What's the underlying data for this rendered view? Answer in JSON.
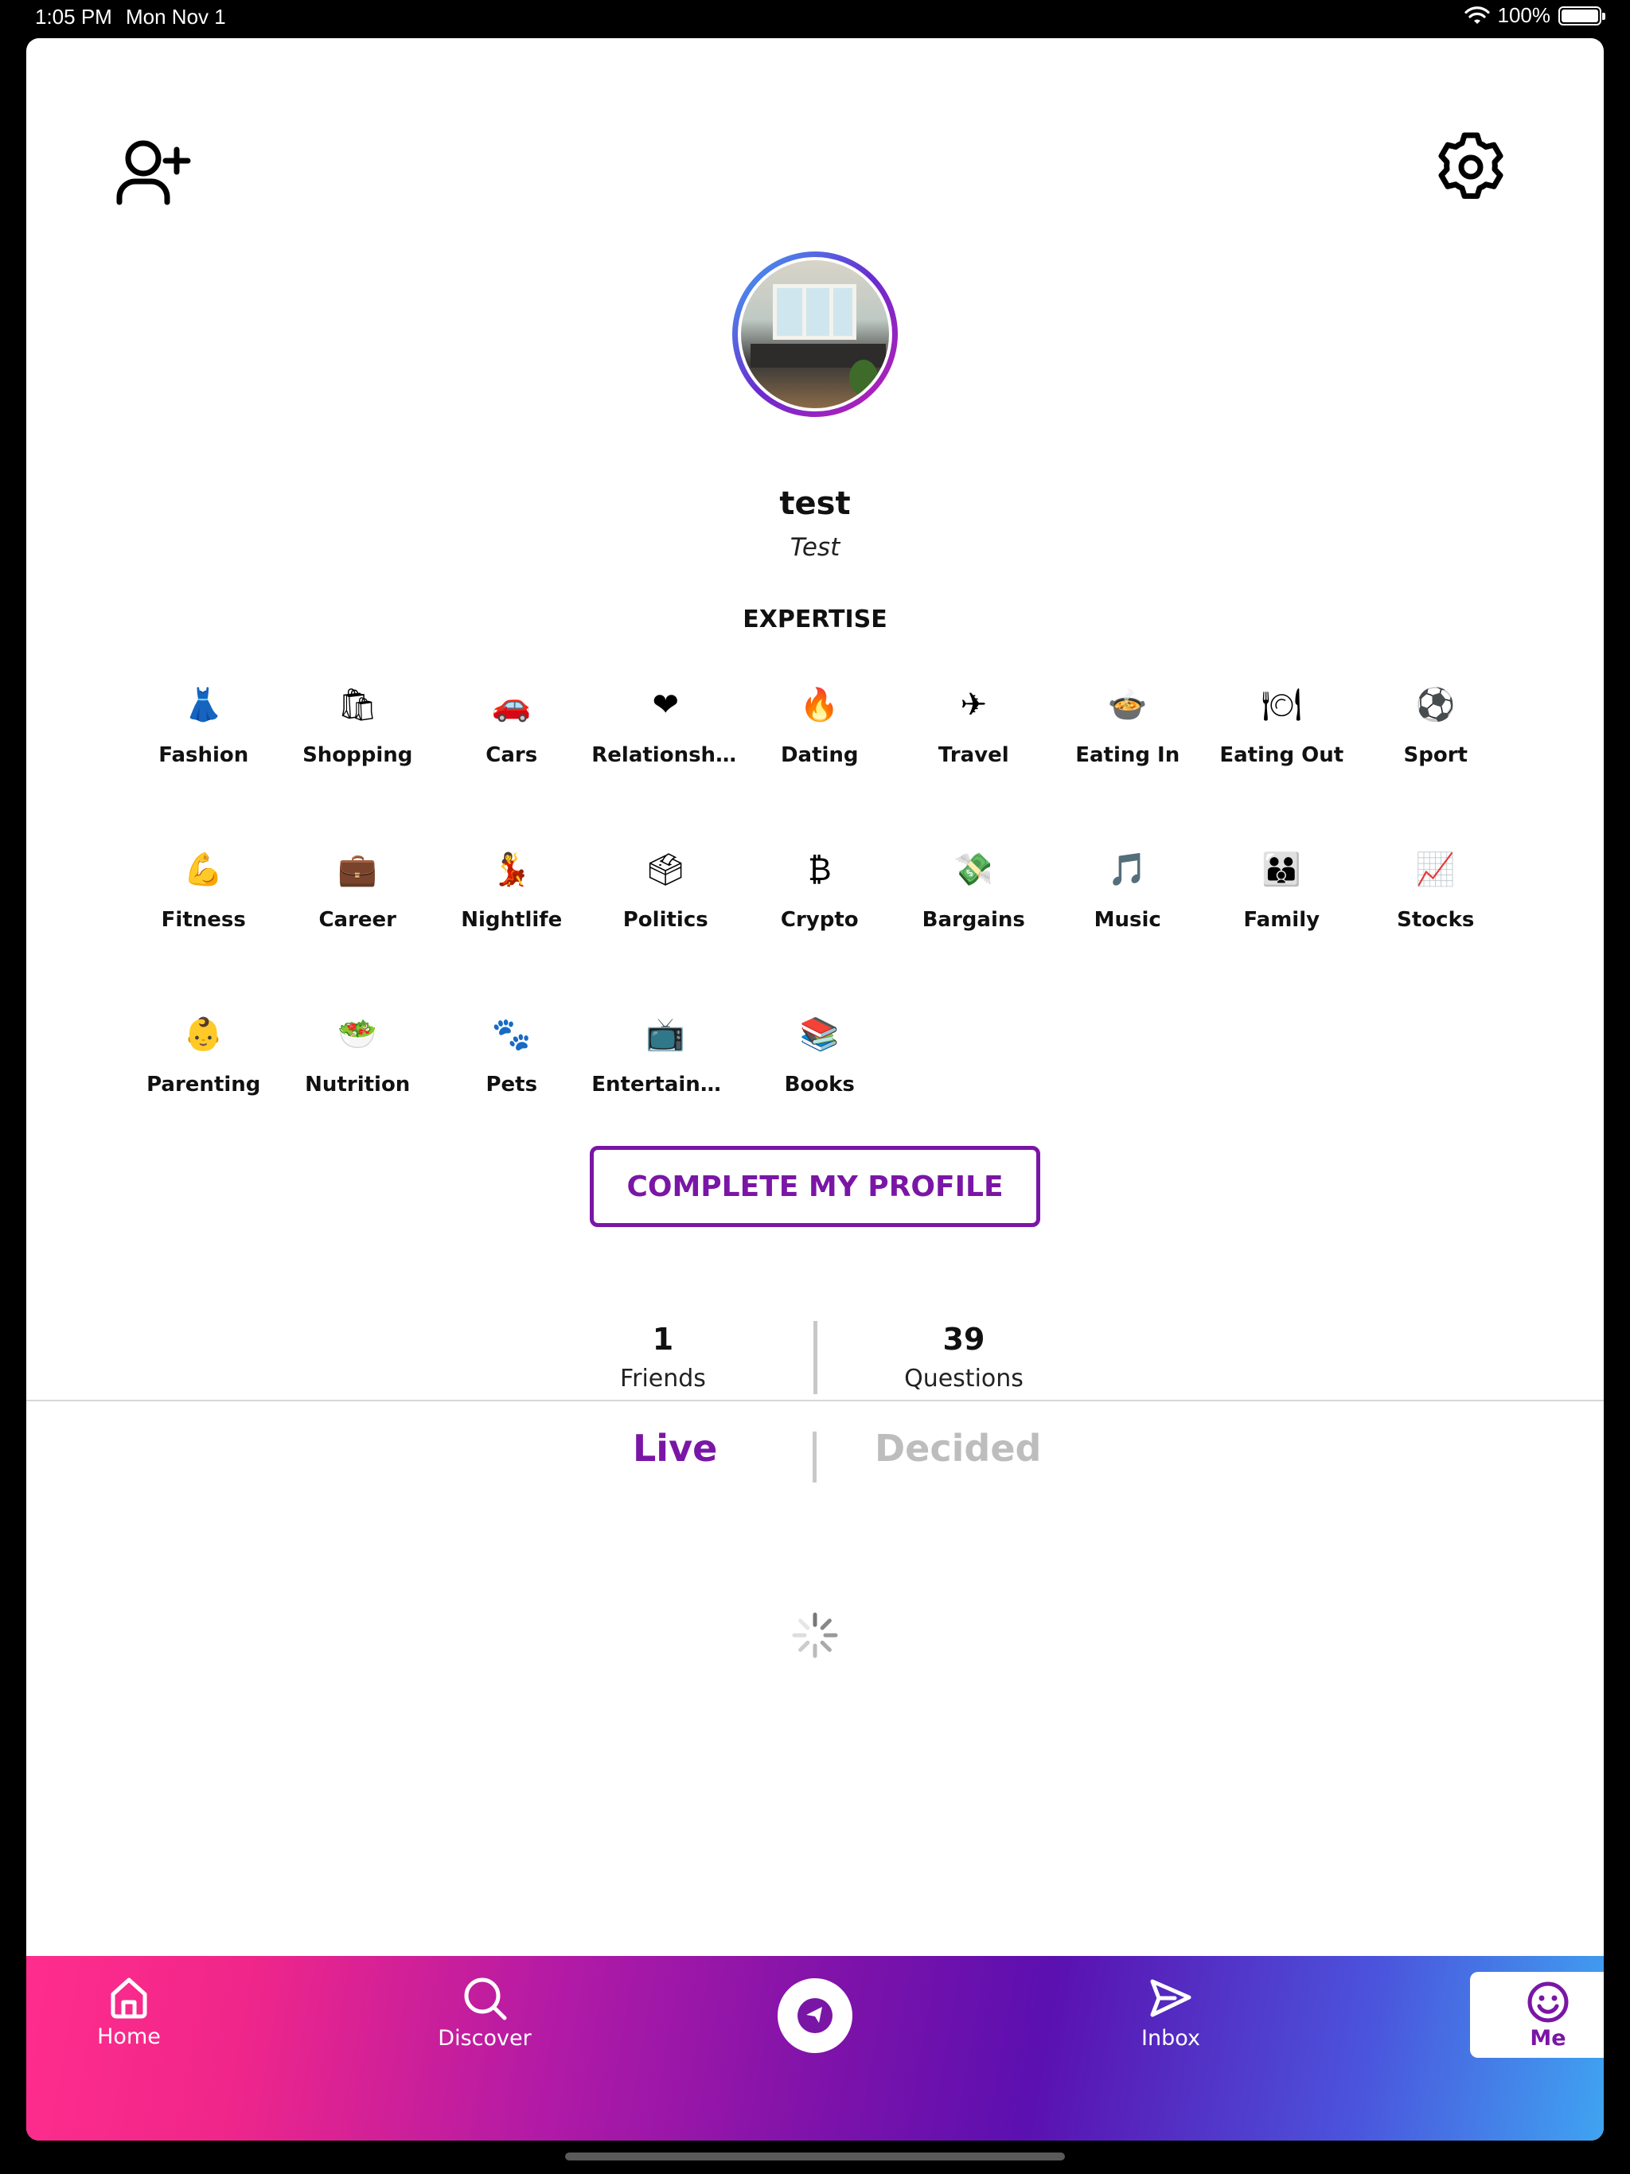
{
  "status_bar": {
    "time": "1:05 PM",
    "date": "Mon Nov 1",
    "wifi_icon": "wifi-icon",
    "battery": "100%"
  },
  "header": {
    "add_friend_icon": "add-user-icon",
    "settings_icon": "gear-icon"
  },
  "profile": {
    "name": "test",
    "subtitle": "Test"
  },
  "expertise": {
    "title": "EXPERTISE",
    "items": [
      {
        "label": "Fashion",
        "icon": "👗"
      },
      {
        "label": "Shopping",
        "icon": "🛍"
      },
      {
        "label": "Cars",
        "icon": "🚗"
      },
      {
        "label": "Relationshi...",
        "icon": "❤"
      },
      {
        "label": "Dating",
        "icon": "🔥"
      },
      {
        "label": "Travel",
        "icon": "✈"
      },
      {
        "label": "Eating In",
        "icon": "🍲"
      },
      {
        "label": "Eating Out",
        "icon": "🍽"
      },
      {
        "label": "Sport",
        "icon": "⚽"
      },
      {
        "label": "Fitness",
        "icon": "💪"
      },
      {
        "label": "Career",
        "icon": "💼"
      },
      {
        "label": "Nightlife",
        "icon": "💃"
      },
      {
        "label": "Politics",
        "icon": "🗳"
      },
      {
        "label": "Crypto",
        "icon": "₿"
      },
      {
        "label": "Bargains",
        "icon": "💸"
      },
      {
        "label": "Music",
        "icon": "🎵"
      },
      {
        "label": "Family",
        "icon": "👪"
      },
      {
        "label": "Stocks",
        "icon": "📈"
      },
      {
        "label": "Parenting",
        "icon": "👶"
      },
      {
        "label": "Nutrition",
        "icon": "🥗"
      },
      {
        "label": "Pets",
        "icon": "🐾"
      },
      {
        "label": "Entertainm...",
        "icon": "📺"
      },
      {
        "label": "Books",
        "icon": "📚"
      }
    ]
  },
  "complete_profile_label": "COMPLETE MY PROFILE",
  "stats": {
    "friends": {
      "value": "1",
      "label": "Friends"
    },
    "questions": {
      "value": "39",
      "label": "Questions"
    }
  },
  "tabs": {
    "live": "Live",
    "decided": "Decided"
  },
  "bottom_nav": {
    "home": "Home",
    "discover": "Discover",
    "inbox": "Inbox",
    "me": "Me"
  },
  "colors": {
    "accent": "#7a16a6",
    "inactive": "#bdbdbd",
    "nav_start": "#ff2d8c",
    "nav_end": "#3fa4f1"
  }
}
